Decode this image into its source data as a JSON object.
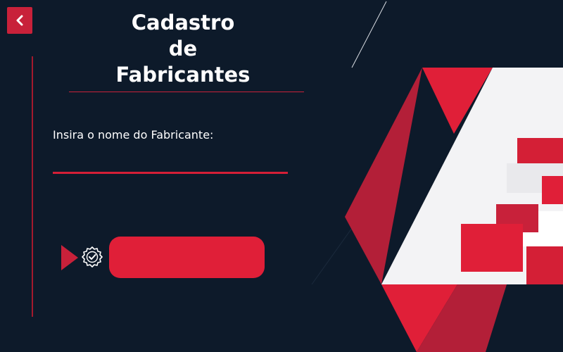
{
  "header": {
    "title_lines": [
      "Cadastro",
      "de",
      "Fabricantes"
    ],
    "back_icon": "chevron-left-icon"
  },
  "form": {
    "label": "Insira o nome do Fabricante:",
    "input_value": "",
    "submit_label": ""
  },
  "icons": {
    "arrow": "play-triangle-icon",
    "badge": "verified-badge-icon"
  },
  "colors": {
    "background": "#0d1a2a",
    "accent": "#c8213a",
    "button": "#e01f38",
    "text": "#ffffff"
  }
}
